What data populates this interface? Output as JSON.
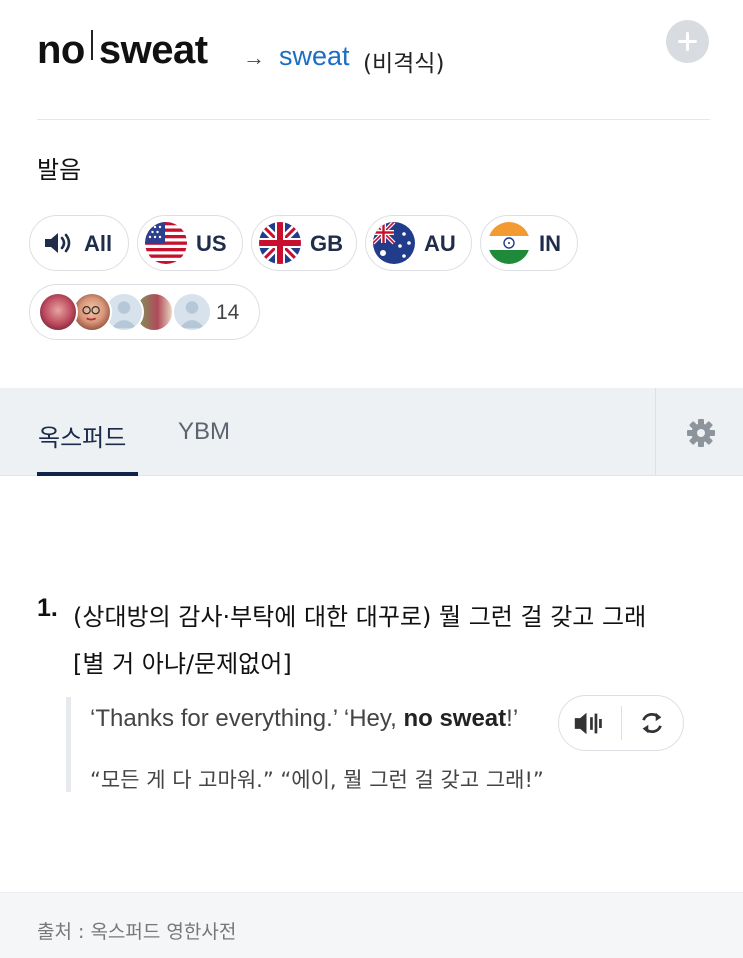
{
  "header": {
    "headword_part1": "no",
    "headword_part2": "sweat",
    "arrow": "→",
    "link_word": "sweat",
    "register": "(비격식)"
  },
  "pronunciation": {
    "label": "발음",
    "chips": [
      {
        "label": "All",
        "icon": "speaker-icon"
      },
      {
        "label": "US",
        "icon": "us-flag-icon"
      },
      {
        "label": "GB",
        "icon": "gb-flag-icon"
      },
      {
        "label": "AU",
        "icon": "au-flag-icon"
      },
      {
        "label": "IN",
        "icon": "in-flag-icon"
      }
    ],
    "contributors_count": "14"
  },
  "tabs": [
    {
      "label": "옥스퍼드",
      "active": true
    },
    {
      "label": "YBM",
      "active": false
    }
  ],
  "sense": {
    "number": "1.",
    "definition_line1": "(상대방의 감사·부탁에 대한 대꾸로) 뭘 그런 걸 갖고 그래",
    "definition_line2": "[별 거 아냐/문제없어]"
  },
  "example": {
    "en_before": "‘Thanks for everything.’ ‘Hey, ",
    "en_bold": "no sweat",
    "en_after": "!’",
    "ko": "“모든 게 다 고마워.” “에이, 뭘 그런 걸 갖고 그래!”"
  },
  "footer": {
    "source": "출처 : 옥스퍼드 영한사전"
  },
  "colors": {
    "link": "#1a6ec4",
    "tab_active_underline": "#12234a",
    "tab_bar_bg": "#eef1f4",
    "chip_text": "#1f2d4a"
  }
}
